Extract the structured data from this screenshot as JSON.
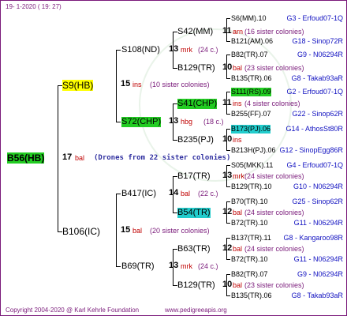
{
  "header": {
    "date": "19-  1-2020 ( 19: 27)"
  },
  "footer": {
    "copyright": "Copyright 2004-2020 @ Karl Kehrle Foundation",
    "site": "www.pedigreeapis.org"
  },
  "root": {
    "name": "B56(HB)",
    "num": "17",
    "note": "bal",
    "drones": "(Drones from 22 sister colonies)"
  },
  "gen1": {
    "s9": {
      "name": "S9(HB)",
      "num": "15",
      "note": "ins",
      "sis": "(10 sister colonies)"
    },
    "b106": {
      "name": "B106(IC)",
      "num": "15",
      "note": "bal",
      "sis": "(20 sister colonies)"
    }
  },
  "gen2": {
    "s108": {
      "name": "S108(ND)",
      "num": "13",
      "note": "mrk",
      "sis": "(24 c.)"
    },
    "s72": {
      "name": "S72(CHP)",
      "num": "13",
      "note": "hbg",
      "sis": "(18 c.)"
    },
    "b417": {
      "name": "B417(IC)",
      "num": "14",
      "note": "bal",
      "sis": "(22 c.)"
    },
    "b69": {
      "name": "B69(TR)",
      "num": "13",
      "note": "mrk",
      "sis": "(24 c.)"
    }
  },
  "gen3": {
    "s42": {
      "name": "S42(MM)",
      "num": "11",
      "note": "arn",
      "sis": "(16 sister colonies)"
    },
    "b129a": {
      "name": "B129(TR)",
      "num": "10",
      "note": "bal",
      "sis": "(23 sister colonies)"
    },
    "s41": {
      "name": "S41(CHP)",
      "num": "11",
      "note": "ins",
      "sis": "(4 sister colonies)"
    },
    "b235": {
      "name": "B235(PJ)",
      "num": "10",
      "note": "ins",
      "sis": ""
    },
    "b17": {
      "name": "B17(TR)",
      "num": "13",
      "note": "mrk",
      "sis": "(24 sister colonies)"
    },
    "b54": {
      "name": "B54(TR)",
      "num": "12",
      "note": "bal",
      "sis": "(24 sister colonies)"
    },
    "b63": {
      "name": "B63(TR)",
      "num": "12",
      "note": "bal",
      "sis": "(24 sister colonies)"
    },
    "b129b": {
      "name": "B129(TR)",
      "num": "10",
      "note": "bal",
      "sis": "(23 sister colonies)"
    }
  },
  "gen4": [
    {
      "name": "S6(MM).10",
      "code": "G3 - Erfoud07-1Q"
    },
    {
      "name": "B121(AM).06",
      "code": "G18 - Sinop72R"
    },
    {
      "name": "B82(TR).07",
      "code": "G9 - N06294R"
    },
    {
      "name": "B135(TR).06",
      "code": "G8 - Takab93aR"
    },
    {
      "name": "S111(RS).09",
      "code": "G2 - Erfoud07-1Q"
    },
    {
      "name": "B255(FF).07",
      "code": "G22 - Sinop62R"
    },
    {
      "name": "B173(PJ).06",
      "code": "G14 - AthosSt80R"
    },
    {
      "name": "B213H(PJ).06",
      "code": "G12 - SinopEgg86R"
    },
    {
      "name": "S05(MKK).11",
      "code": "G4 - Erfoud07-1Q"
    },
    {
      "name": "B129(TR).10",
      "code": "G10 - N06294R"
    },
    {
      "name": "B70(TR).10",
      "code": "G25 - Sinop62R"
    },
    {
      "name": "B72(TR).10",
      "code": "G11 - N06294R"
    },
    {
      "name": "B137(TR).11",
      "code": "G8 - Kangaroo98R"
    },
    {
      "name": "B72(TR).10",
      "code": "G11 - N06294R"
    },
    {
      "name": "B82(TR).07",
      "code": "G9 - N06294R"
    },
    {
      "name": "B135(TR).06",
      "code": "G8 - Takab93aR"
    }
  ]
}
